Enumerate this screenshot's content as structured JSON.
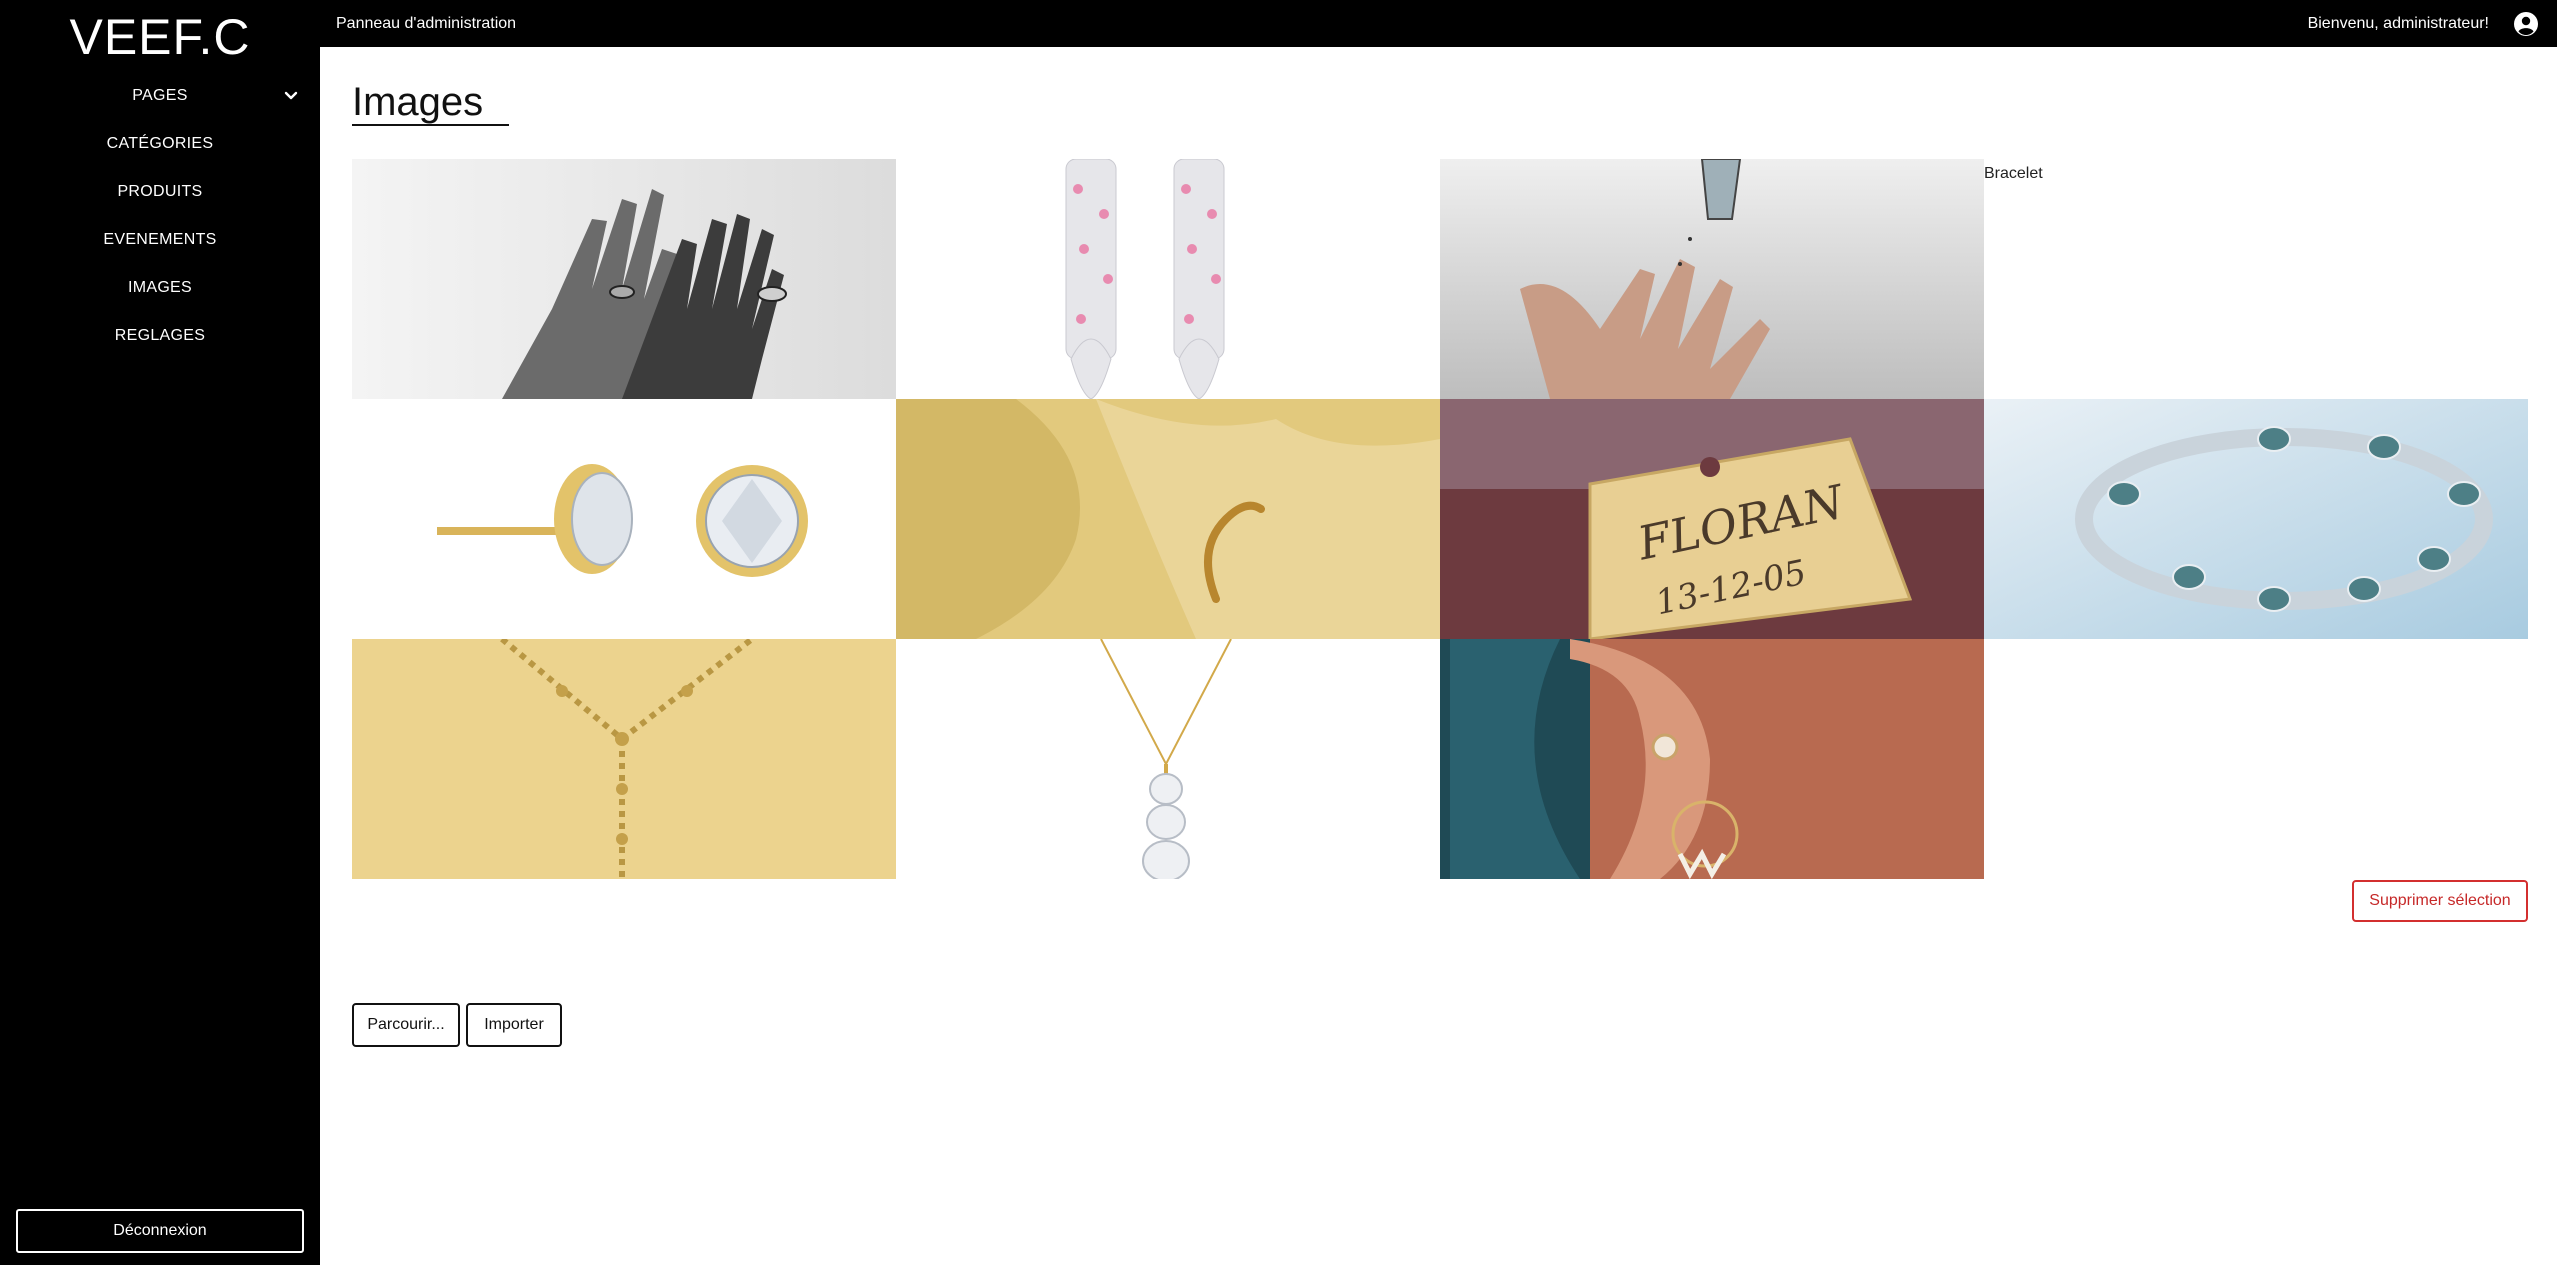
{
  "sidebar": {
    "logo": "VEEF.C",
    "items": [
      {
        "label": "PAGES"
      },
      {
        "label": "CATÉGORIES"
      },
      {
        "label": "PRODUITS"
      },
      {
        "label": "EVENEMENTS"
      },
      {
        "label": "IMAGES"
      },
      {
        "label": "REGLAGES"
      }
    ],
    "logout_label": "Déconnexion"
  },
  "topbar": {
    "title": "Panneau d'administration",
    "welcome": "Bienvenu, administrateur!"
  },
  "main": {
    "title": "Images",
    "images": [
      {
        "subject": "hands with rings"
      },
      {
        "subject": "diamond earrings"
      },
      {
        "subject": "hand with falling diamond"
      },
      {
        "broken_alt": "Bracelet"
      },
      {
        "subject": "gold stud earrings"
      },
      {
        "subject": "gold ring on cloth"
      },
      {
        "subject": "engraved tag",
        "engraving_name": "FLORAN",
        "engraving_date": "13-12-05"
      },
      {
        "subject": "diamond bracelet"
      },
      {
        "subject": "gold necklace"
      },
      {
        "subject": "pendant necklace"
      },
      {
        "subject": "ear with earrings"
      }
    ],
    "delete_label": "Supprimer sélection",
    "browse_label": "Parcourir...",
    "import_label": "Importer"
  },
  "colors": {
    "sidebar_bg": "#000000",
    "delete_red": "#c62828"
  }
}
